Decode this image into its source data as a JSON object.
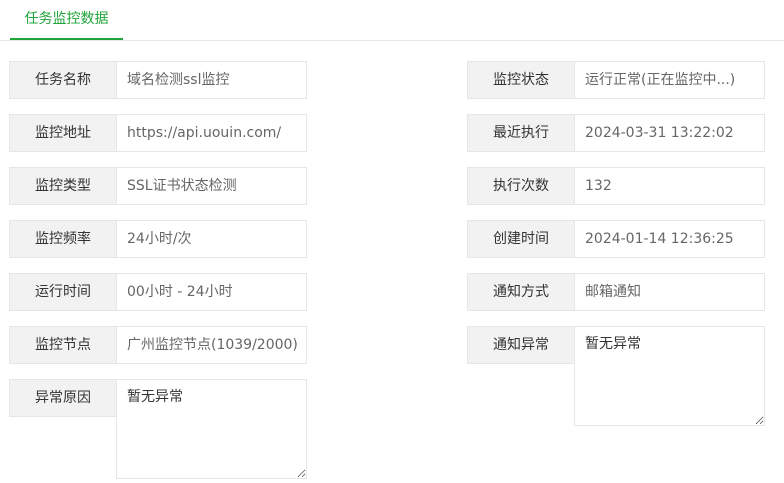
{
  "tabs": [
    {
      "label": "任务监控数据"
    }
  ],
  "left": [
    {
      "label": "任务名称",
      "value": "域名检测ssl监控"
    },
    {
      "label": "监控地址",
      "value": "https://api.uouin.com/"
    },
    {
      "label": "监控类型",
      "value": "SSL证书状态检测"
    },
    {
      "label": "监控频率",
      "value": "24小时/次"
    },
    {
      "label": "运行时间",
      "value": "00小时 - 24小时"
    },
    {
      "label": "监控节点",
      "value": "广州监控节点(1039/2000)"
    },
    {
      "label": "异常原因",
      "value": "暂无异常"
    }
  ],
  "right": [
    {
      "label": "监控状态",
      "value": "运行正常(正在监控中...)"
    },
    {
      "label": "最近执行",
      "value": "2024-03-31 13:22:02"
    },
    {
      "label": "执行次数",
      "value": "132"
    },
    {
      "label": "创建时间",
      "value": "2024-01-14 12:36:25"
    },
    {
      "label": "通知方式",
      "value": "邮箱通知"
    },
    {
      "label": "通知异常",
      "value": "暂无异常"
    }
  ]
}
